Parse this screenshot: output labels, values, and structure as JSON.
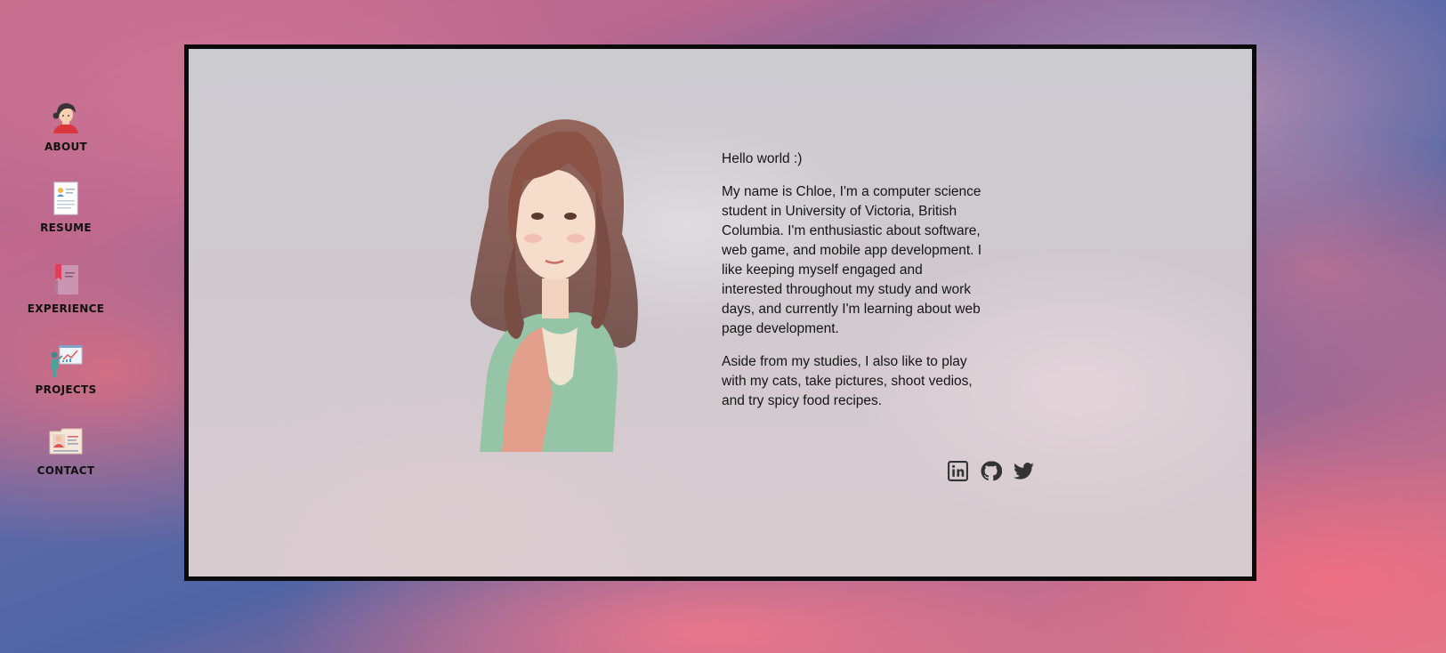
{
  "nav": {
    "items": [
      {
        "label": "ABOUT",
        "icon": "avatar-icon"
      },
      {
        "label": "RESUME",
        "icon": "resume-icon"
      },
      {
        "label": "EXPERIENCE",
        "icon": "book-icon"
      },
      {
        "label": "PROJECTS",
        "icon": "presentation-icon"
      },
      {
        "label": "CONTACT",
        "icon": "id-card-icon"
      }
    ]
  },
  "bio": {
    "greeting": "Hello world :)",
    "paragraph1": "My name is Chloe, I'm a computer science student in University of Victoria, British Columbia. I'm enthusiastic about software, web game, and mobile app development. I like keeping myself engaged and interested throughout my study and work days, and currently I'm learning about web page development.",
    "paragraph2": "Aside from my studies, I also like to play with my cats, take pictures, shoot vedios, and try spicy food recipes."
  },
  "social": {
    "icons": [
      "linkedin-icon",
      "github-icon",
      "twitter-icon"
    ]
  },
  "colors": {
    "panel_border": "#0b0b0b",
    "text": "#161616",
    "icon": "#333333"
  }
}
